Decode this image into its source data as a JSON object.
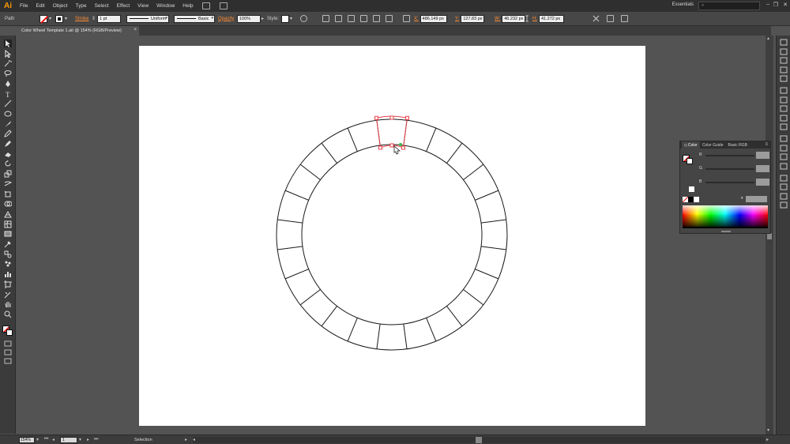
{
  "app": {
    "logo": "Ai",
    "workspace": "Essentials"
  },
  "menu": [
    "File",
    "Edit",
    "Object",
    "Type",
    "Select",
    "Effect",
    "View",
    "Window",
    "Help"
  ],
  "control_bar": {
    "selection_type": "Path",
    "stroke_label": "Stroke",
    "stroke_weight": "1 pt",
    "profile": "Uniform",
    "brush": "Basic",
    "opacity_label": "Opacity",
    "opacity": "100%",
    "style_label": "Style:",
    "x": "486.149 px",
    "y": "127.83 px",
    "w": "46.232 px",
    "h": "41.272 px"
  },
  "document_tab": {
    "title": "Color Wheel Template 1.ait @ 154% (RGB/Preview)",
    "close": "×"
  },
  "color_panel": {
    "tabs": [
      "Color",
      "Color Guide",
      "Basic RGB"
    ],
    "channels": [
      "R",
      "G",
      "B"
    ],
    "menu_glyph": "≡"
  },
  "status_bar": {
    "zoom": "154%",
    "page": "1",
    "tool": "Selection"
  },
  "artwork": {
    "segments": 24,
    "stroke_color": "#1a1a1a",
    "selection_color": "#e8404a",
    "selected_segment": 0
  },
  "window_controls": [
    "–",
    "❐",
    "✕"
  ]
}
